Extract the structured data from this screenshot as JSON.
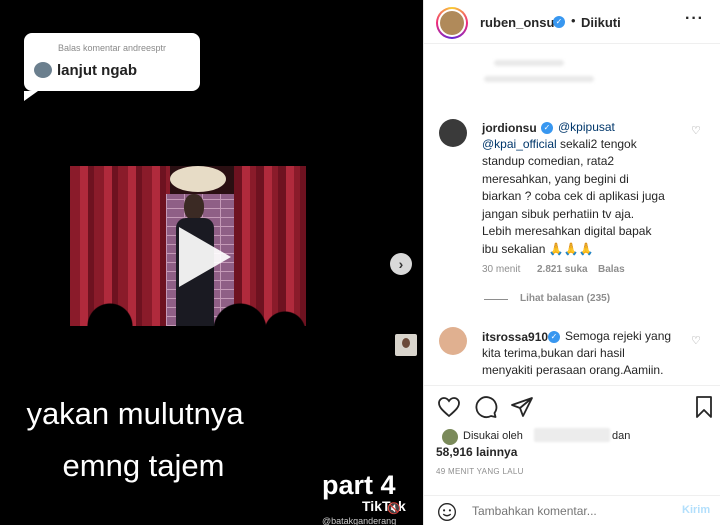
{
  "media": {
    "reply_bubble": {
      "reply_to": "Balas komentar andreesptr",
      "text": "lanjut ngab"
    },
    "caption_line1": "yakan mulutnya",
    "caption_line2": "emng tajem",
    "part_label": "part 4",
    "tiktok_label": "TikTok",
    "tiktok_handle": "@batakganderang",
    "next_arrow": "›",
    "mute_icon": "🔇"
  },
  "post": {
    "username": "ruben_onsu",
    "separator": "•",
    "follow_status": "Diikuti",
    "more": "···"
  },
  "comments": [
    {
      "username": "jordionsu",
      "mention1": "@kpipusat",
      "mention2": "@kpai_official",
      "line1_rest": " sekali2 tengok",
      "line2": "standup comedian, rata2",
      "line3": "meresahkan, yang begini di",
      "line4": "biarkan ? coba cek di aplikasi juga",
      "line5": "jangan sibuk perhatiin tv aja.",
      "line6": "Lebih meresahkan digital bapak",
      "line7": "ibu sekalian 🙏🙏🙏",
      "time": "30 menit",
      "likes": "2.821 suka",
      "reply": "Balas",
      "view_replies": "Lihat balasan (235)"
    },
    {
      "username": "itsrossa910",
      "line1": "Semoga rejeki yang",
      "line2": "kita terima,bukan dari hasil",
      "line3": "menyakiti perasaan orang.Aamiin."
    }
  ],
  "likes": {
    "prefix": "Disukai oleh",
    "suffix": "dan",
    "count": "58,916 lainnya"
  },
  "time_ago": "49 MENIT YANG LALU",
  "add_comment": {
    "placeholder": "Tambahkan komentar...",
    "post_label": "Kirim"
  },
  "colors": {
    "verified": "#3897f0",
    "mention": "#00376b",
    "post_button": "#b2dffc"
  }
}
